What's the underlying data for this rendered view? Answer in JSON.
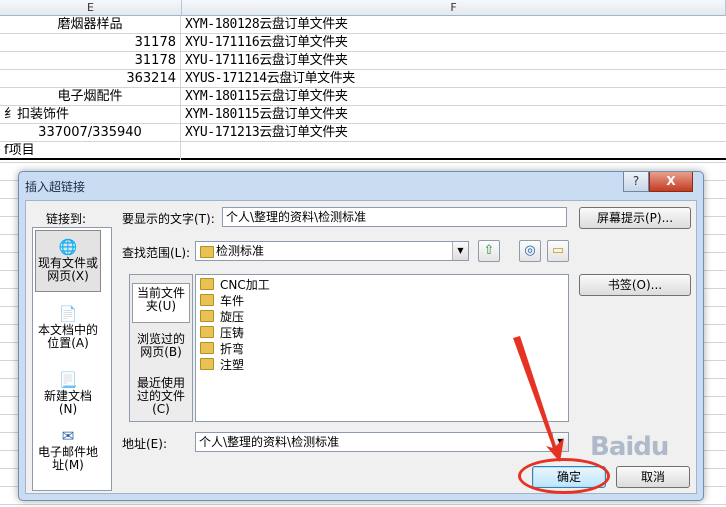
{
  "columns": {
    "e": "E",
    "f": "F"
  },
  "rows": [
    {
      "e": "磨烟器样品",
      "e_align": "center",
      "f": "XYM-180128云盘订单文件夹"
    },
    {
      "e": "31178",
      "e_align": "right",
      "f": "XYU-171116云盘订单文件夹"
    },
    {
      "e": "31178",
      "e_align": "right",
      "f": "XYU-171116云盘订单文件夹"
    },
    {
      "e": "363214",
      "e_align": "right",
      "f": "XYUS-171214云盘订单文件夹"
    },
    {
      "e": "电子烟配件",
      "e_align": "center",
      "f": "XYM-180115云盘订单文件夹"
    },
    {
      "e": "纟扣装饰件",
      "e_align": "left",
      "f": "XYM-180115云盘订单文件夹"
    },
    {
      "e": "337007/335940",
      "e_align": "center",
      "f": "XYU-171213云盘订单文件夹"
    },
    {
      "e": "f项目",
      "e_align": "left",
      "f": ""
    }
  ],
  "dialog": {
    "title": "插入超链接",
    "help_label": "?",
    "close_label": "X",
    "link_to_label": "链接到:",
    "link_options": [
      {
        "label": "现有文件或网页(X)",
        "icon": "web-file-icon"
      },
      {
        "label": "本文档中的位置(A)",
        "icon": "document-place-icon"
      },
      {
        "label": "新建文档(N)",
        "icon": "new-document-icon"
      },
      {
        "label": "电子邮件地址(M)",
        "icon": "email-icon"
      }
    ],
    "display_text_label": "要显示的文字(T):",
    "display_text_value": "个人\\整理的资料\\检测标准",
    "screentip_label": "屏幕提示(P)...",
    "lookin_label": "查找范围(L):",
    "lookin_value": "检测标准",
    "bookmark_label": "书签(O)...",
    "side_options": [
      {
        "label": "当前文件夹(U)"
      },
      {
        "label": "浏览过的网页(B)"
      },
      {
        "label": "最近使用过的文件(C)"
      }
    ],
    "files": [
      "CNC加工",
      "车件",
      "旋压",
      "压铸",
      "折弯",
      "注塑"
    ],
    "address_label": "地址(E):",
    "address_value": "个人\\整理的资料\\检测标准",
    "ok_label": "确定",
    "cancel_label": "取消"
  },
  "watermark": "Baidu"
}
